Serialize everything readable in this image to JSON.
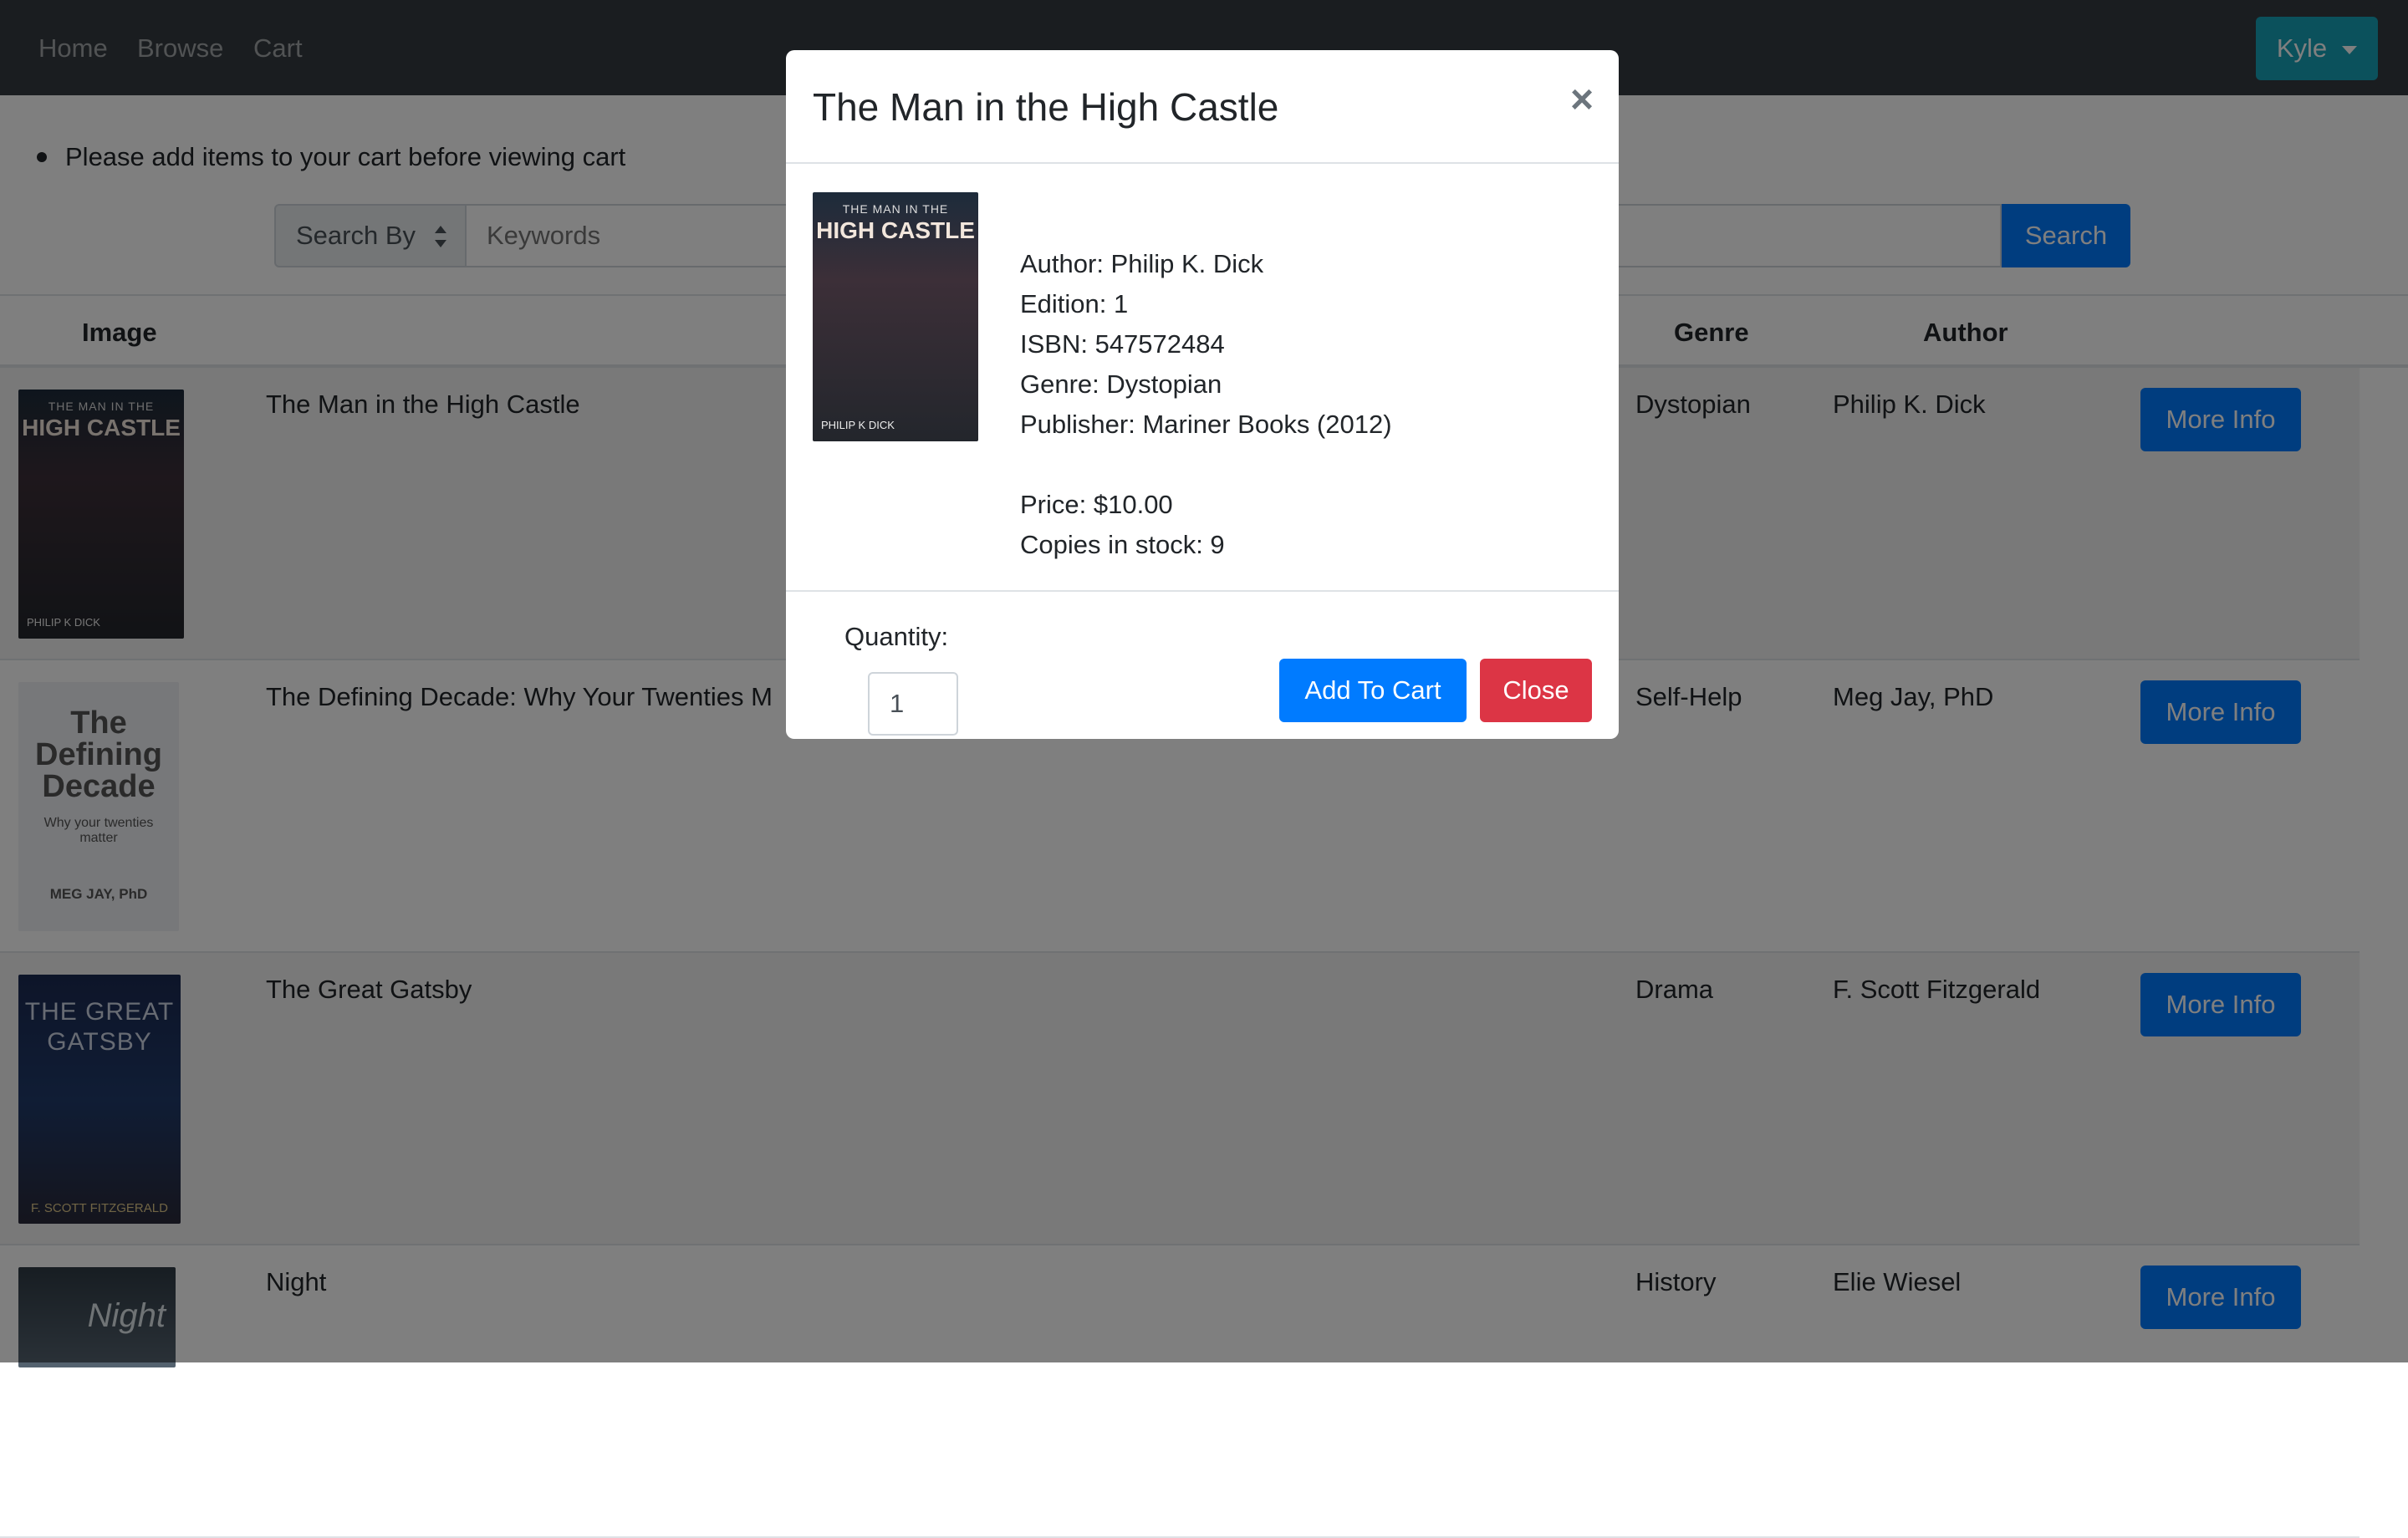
{
  "navbar": {
    "links": [
      "Home",
      "Browse",
      "Cart"
    ],
    "user_label": "Kyle"
  },
  "alert": {
    "message": "Please add items to your cart before viewing cart"
  },
  "search": {
    "search_by_label": "Search By",
    "keywords_placeholder": "Keywords",
    "button_label": "Search"
  },
  "table": {
    "headers": {
      "image": "Image",
      "genre": "Genre",
      "author": "Author"
    },
    "more_info_label": "More Info",
    "rows": [
      {
        "title": "The Man in the High Castle",
        "genre": "Dystopian",
        "author": "Philip K. Dick",
        "cover": {
          "line1": "THE MAN IN THE",
          "line2": "HIGH CASTLE",
          "author": "PHILIP K DICK"
        }
      },
      {
        "title": "The Defining Decade: Why Your Twenties M",
        "genre": "Self-Help",
        "author": "Meg Jay, PhD",
        "cover": {
          "line1": "The Defining Decade",
          "line2": "Why your twenties matter",
          "author": "MEG JAY, PhD"
        }
      },
      {
        "title": "The Great Gatsby",
        "genre": "Drama",
        "author": "F. Scott Fitzgerald",
        "cover": {
          "line1": "THE GREAT",
          "line2": "GATSBY",
          "author": "F. SCOTT FITZGERALD"
        }
      },
      {
        "title": "Night",
        "genre": "History",
        "author": "Elie Wiesel",
        "cover": {
          "line1": "Night",
          "line2": "",
          "author": ""
        }
      }
    ]
  },
  "modal": {
    "title": "The Man in the High Castle",
    "close_symbol": "×",
    "cover": {
      "line1": "THE MAN IN THE",
      "line2": "HIGH CASTLE",
      "author": "PHILIP K DICK"
    },
    "author": "Author: Philip K. Dick",
    "edition": "Edition: 1",
    "isbn": "ISBN: 547572484",
    "genre": "Genre: Dystopian",
    "publisher": "Publisher: Mariner Books (2012)",
    "price": "Price: $10.00",
    "stock": "Copies in stock: 9",
    "quantity_label": "Quantity:",
    "quantity_value": "1",
    "add_label": "Add To Cart",
    "close_label": "Close"
  }
}
